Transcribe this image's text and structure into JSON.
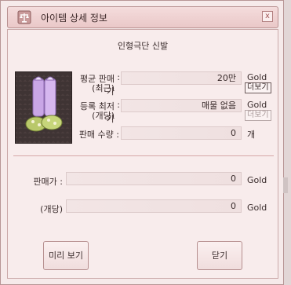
{
  "window": {
    "title": "아이템 상세 정보",
    "close_label": "x"
  },
  "item": {
    "name": "인형극단 신발"
  },
  "market": {
    "avg_price_label": "평균 판매가",
    "avg_price_sub": "(최근)",
    "avg_price_value": "20만",
    "avg_price_unit": "Gold",
    "avg_more": "더보기",
    "lowest_label": "등록 최저가",
    "lowest_sub": "(개당)",
    "lowest_value": "매물 없음",
    "lowest_unit": "Gold",
    "lowest_more": "더보기",
    "qty_label": "판매 수량 :",
    "qty_value": "0",
    "qty_unit": "개",
    "colon": ":"
  },
  "sale": {
    "price_label": "판매가 :",
    "price_value": "0",
    "price_unit": "Gold",
    "each_label": "(개당)",
    "each_value": "0",
    "each_unit": "Gold"
  },
  "buttons": {
    "preview": "미리 보기",
    "close": "닫기"
  }
}
